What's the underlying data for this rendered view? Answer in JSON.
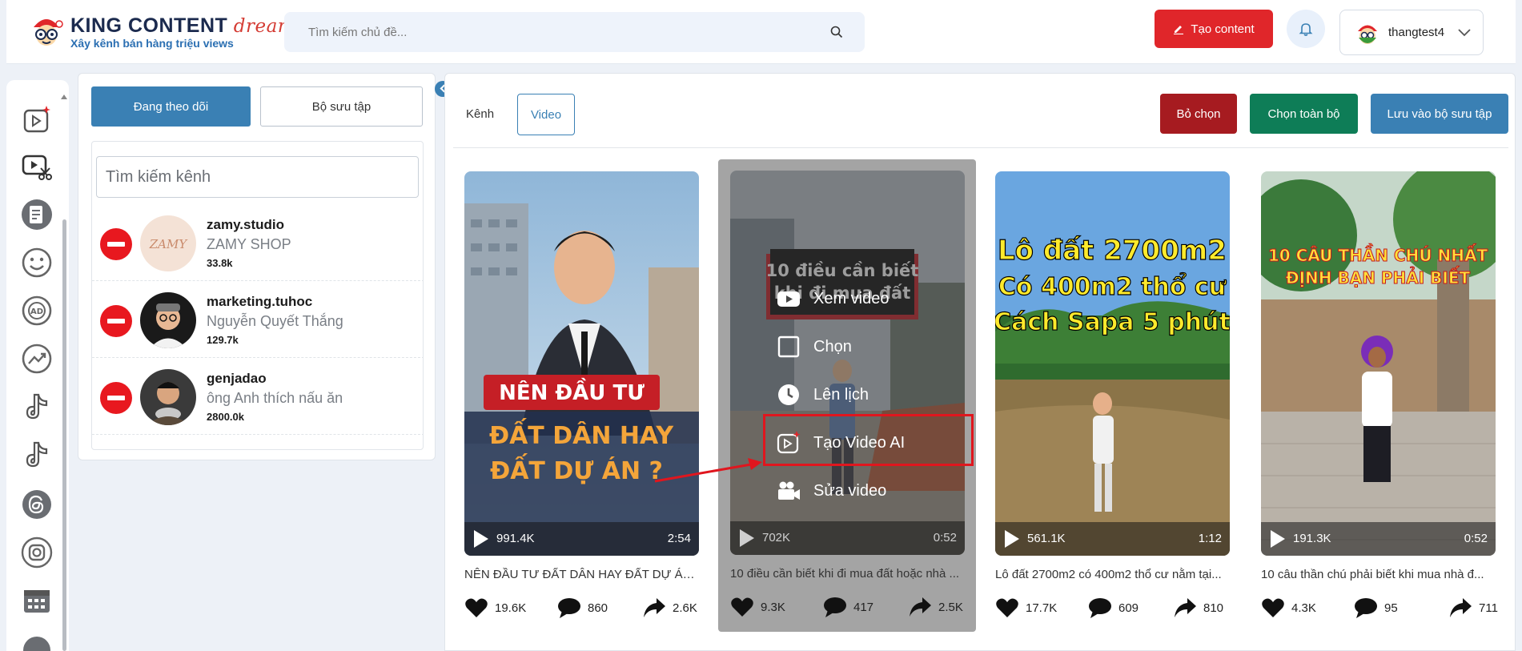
{
  "header": {
    "logo_title_main": "KING CONTENT",
    "logo_title_accent": "dream",
    "logo_subtitle": "Xây kênh bán hàng triệu views",
    "search_placeholder": "Tìm kiếm chủ đề...",
    "create_button": "Tạo content",
    "username": "thangtest4"
  },
  "sidebar_icons": [
    "video-spark-icon",
    "video-edit-icon",
    "document-icon",
    "smiley-icon",
    "ad-icon",
    "trend-icon",
    "tiktok-icon",
    "tiktok-alt-icon",
    "threads-icon",
    "instagram-icon",
    "calendar-icon"
  ],
  "channel_panel": {
    "tab_following": "Đang theo dõi",
    "tab_collection": "Bộ sưu tập",
    "search_placeholder": "Tìm kiếm kênh",
    "channels": [
      {
        "handle": "zamy.studio",
        "name": "ZAMY SHOP",
        "followers": "33.8k",
        "avatar_text": "ZAMY"
      },
      {
        "handle": "marketing.tuhoc",
        "name": "Nguyễn Quyết Thắng",
        "followers": "129.7k"
      },
      {
        "handle": "genjadao",
        "name": "ông Anh thích nấu ăn",
        "followers": "2800.0k"
      }
    ]
  },
  "toolbar": {
    "filter_label": "Kênh",
    "filter_video": "Video",
    "deselect": "Bỏ chọn",
    "select_all": "Chọn toàn bộ",
    "save_collection": "Lưu vào bộ sưu tập"
  },
  "videos": [
    {
      "overlay_line1": "NÊN ĐẦU TƯ",
      "overlay_line2": "ĐẤT DÂN HAY",
      "overlay_line3": "ĐẤT DỰ ÁN ?",
      "views": "991.4K",
      "duration": "2:54",
      "title": "NÊN ĐẦU TƯ ĐẤT DÂN HAY ĐẤT DỰ ÁN?...",
      "likes": "19.6K",
      "comments": "860",
      "shares": "2.6K"
    },
    {
      "overlay_line1": "10 điều cần biết",
      "overlay_line2": "khi đi mua đất",
      "views": "702K",
      "duration": "0:52",
      "title": "10 điều cần biết khi đi mua đất hoặc nhà ...",
      "likes": "9.3K",
      "comments": "417",
      "shares": "2.5K"
    },
    {
      "overlay_line1": "Lô đất 2700m2",
      "overlay_line2": "Có 400m2 thổ cư",
      "overlay_line3": "Cách Sapa 5 phút",
      "views": "561.1K",
      "duration": "1:12",
      "title": "Lô đất 2700m2 có 400m2 thổ cư nằm tại...",
      "likes": "17.7K",
      "comments": "609",
      "shares": "810"
    },
    {
      "overlay_line1": "10 CÂU THẦN CHÚ NHẤT",
      "overlay_line2": "ĐỊNH BẠN PHẢI BIẾT",
      "views": "191.3K",
      "duration": "0:52",
      "title": "10 câu thần chú phải biết khi mua nhà đ...",
      "likes": "4.3K",
      "comments": "95",
      "shares": "711"
    }
  ],
  "hover_menu": {
    "watch": "Xem video",
    "select": "Chọn",
    "schedule": "Lên lịch",
    "create_ai": "Tạo Video AI",
    "edit": "Sửa video"
  },
  "colors": {
    "primary": "#3a80b4",
    "danger": "#e0262a",
    "dark_red": "#a61b20",
    "green": "#0e7d57"
  }
}
